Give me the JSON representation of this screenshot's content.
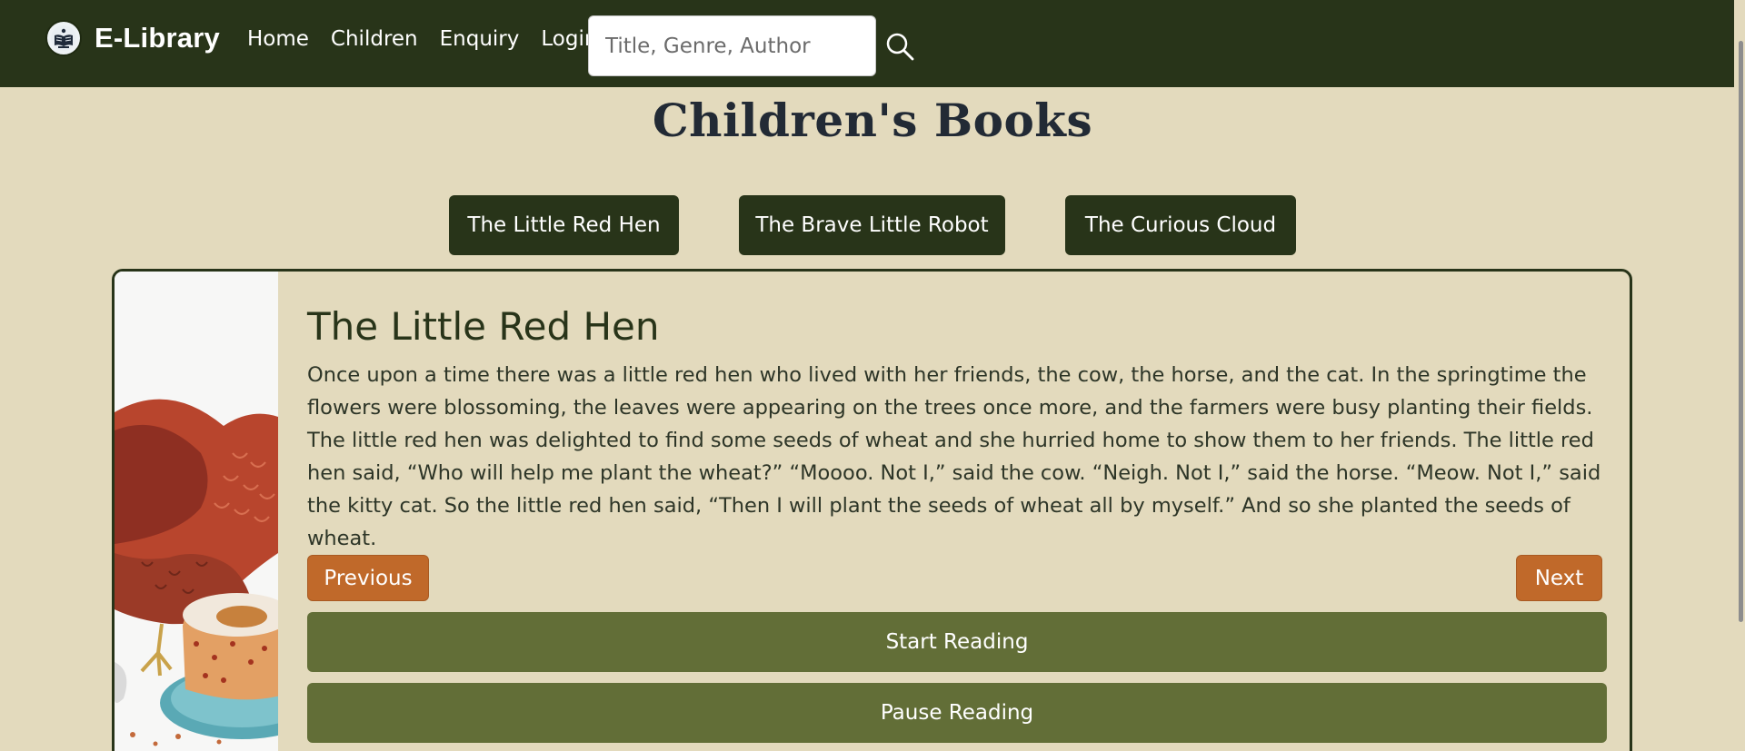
{
  "brand": {
    "name": "E-Library",
    "logo_icon": "library-book-icon"
  },
  "nav": {
    "links": [
      "Home",
      "Children",
      "Enquiry",
      "Login"
    ]
  },
  "search": {
    "placeholder": "Title, Genre, Author",
    "value": "",
    "icon": "search-icon"
  },
  "page": {
    "title": "Children's Books"
  },
  "tabs": [
    "The Little Red Hen",
    "The Brave Little Robot",
    "The Curious Cloud"
  ],
  "book": {
    "title": "The Little Red Hen",
    "text": "Once upon a time there was a little red hen who lived with her friends, the cow, the horse, and the cat. In the springtime the flowers were blossoming, the leaves were appearing on the trees once more, and the farmers were busy planting their fields. The little red hen was delighted to find some seeds of wheat and she hurried home to show them to her friends. The little red hen said, “Who will help me plant the wheat?” “Moooo. Not I,” said the cow. “Neigh. Not I,” said the horse. “Meow. Not I,” said the kitty cat. So the little red hen said, “Then I will plant the seeds of wheat all by myself.” And so she planted the seeds of wheat.",
    "image": "little-red-hen-illustration"
  },
  "controls": {
    "previous": "Previous",
    "next": "Next",
    "start": "Start Reading",
    "pause": "Pause Reading"
  },
  "colors": {
    "navbar": "#283419",
    "background": "#e3dabd",
    "accent_orange": "#c0692a",
    "button_olive": "#626e37"
  }
}
